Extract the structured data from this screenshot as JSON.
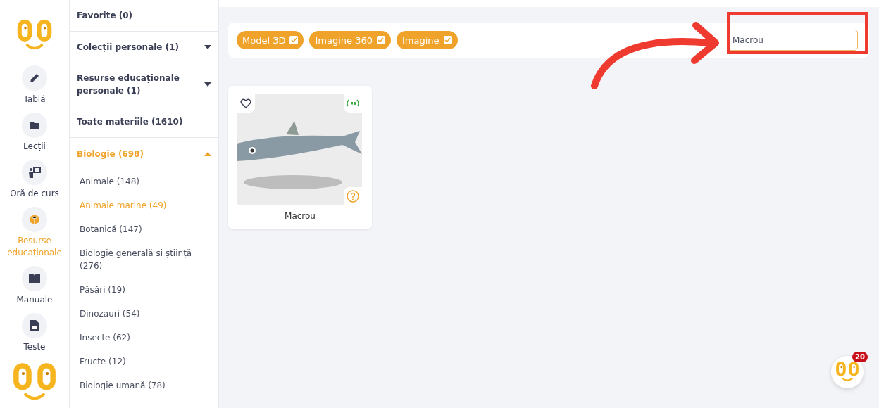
{
  "nav": [
    {
      "label": "Tablă",
      "selected": false
    },
    {
      "label": "Lecții",
      "selected": false
    },
    {
      "label": "Oră de curs",
      "selected": false
    },
    {
      "label": "Resurse educaționale",
      "selected": true
    },
    {
      "label": "Manuale",
      "selected": false
    },
    {
      "label": "Teste",
      "selected": false
    }
  ],
  "sections": [
    {
      "label": "Favorite (0)",
      "selected": false
    },
    {
      "label": "Colecții personale (1)",
      "selected": false,
      "expanded": false
    },
    {
      "label": "Resurse educaționale personale (1)",
      "selected": false,
      "expanded": false
    },
    {
      "label": "Toate materiile (1610)",
      "selected": false
    },
    {
      "label": "Biologie (698)",
      "selected": true,
      "expanded": true,
      "children": [
        {
          "label": "Animale (148)",
          "selected": false
        },
        {
          "label": "Animale marine (49)",
          "selected": true
        },
        {
          "label": "Botanică (147)",
          "selected": false
        },
        {
          "label": "Biologie generală și știință (276)",
          "selected": false
        },
        {
          "label": "Păsări (19)",
          "selected": false
        },
        {
          "label": "Dinozauri (54)",
          "selected": false
        },
        {
          "label": "Insecte (62)",
          "selected": false
        },
        {
          "label": "Fructe (12)",
          "selected": false
        },
        {
          "label": "Biologie umană (78)",
          "selected": false
        }
      ]
    }
  ],
  "filters": [
    {
      "label": "Model 3D",
      "checked": true
    },
    {
      "label": "Imagine 360",
      "checked": true
    },
    {
      "label": "Imagine",
      "checked": true
    }
  ],
  "search": {
    "value": "Macrou"
  },
  "cards": [
    {
      "title": "Macrou",
      "favorite": false,
      "kind": "model"
    }
  ],
  "assistant": {
    "badge": "20"
  }
}
